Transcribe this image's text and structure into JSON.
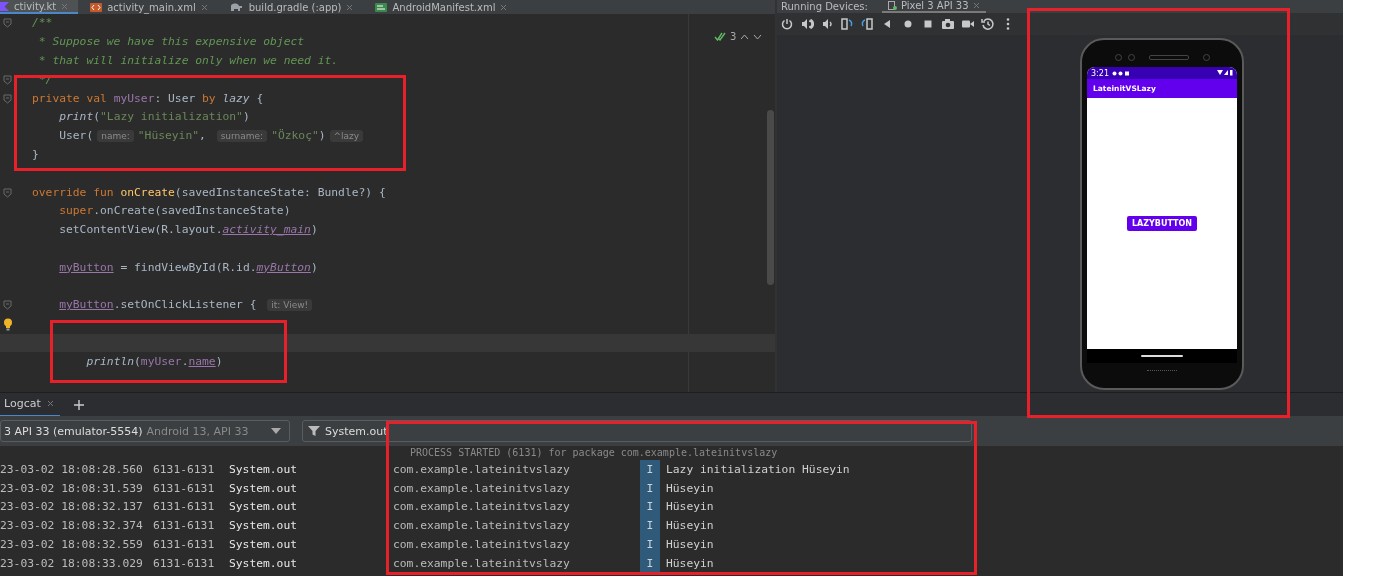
{
  "editor_tabs": [
    {
      "label": "ctivity.kt",
      "kind": "kotlin",
      "selected": true
    },
    {
      "label": "activity_main.xml",
      "kind": "xml",
      "selected": false
    },
    {
      "label": "build.gradle (:app)",
      "kind": "gradle",
      "selected": false
    },
    {
      "label": "AndroidManifest.xml",
      "kind": "manifest",
      "selected": false
    }
  ],
  "inspections": {
    "count": "3"
  },
  "code_lines": [
    {
      "kind": "fold",
      "current": false,
      "tokens": [
        {
          "kind": "comment",
          "text": "/**"
        }
      ]
    },
    {
      "kind": "plain",
      "current": false,
      "tokens": [
        {
          "kind": "comment",
          "text": " * Suppose we have this expensive object"
        }
      ]
    },
    {
      "kind": "plain",
      "current": false,
      "tokens": [
        {
          "kind": "comment",
          "text": " * that will initialize only when we need it."
        }
      ]
    },
    {
      "kind": "fold",
      "current": false,
      "tokens": [
        {
          "kind": "comment",
          "text": " */"
        }
      ]
    },
    {
      "kind": "fold",
      "current": false,
      "tokens": [
        {
          "kind": "keyword",
          "text": "private val "
        },
        {
          "kind": "property",
          "text": "myUser"
        },
        {
          "kind": "plain",
          "text": ": User "
        },
        {
          "kind": "keyword",
          "text": "by "
        },
        {
          "kind": "italic",
          "text": "lazy"
        },
        {
          "kind": "plain",
          "text": " {"
        }
      ]
    },
    {
      "kind": "plain",
      "current": false,
      "tokens": [
        {
          "kind": "italic",
          "text": "    print"
        },
        {
          "kind": "plain",
          "text": "("
        },
        {
          "kind": "string",
          "text": "\"Lazy initialization\""
        },
        {
          "kind": "plain",
          "text": ")"
        }
      ]
    },
    {
      "kind": "plain",
      "current": false,
      "tokens": [
        {
          "kind": "plain",
          "text": "    User("
        },
        {
          "kind": "hint",
          "text": "name:"
        },
        {
          "kind": "string",
          "text": "\"Hüseyin\""
        },
        {
          "kind": "plain",
          "text": ", "
        },
        {
          "kind": "hint",
          "text": "surname:"
        },
        {
          "kind": "string",
          "text": "\"Özkoç\""
        },
        {
          "kind": "plain",
          "text": ")"
        },
        {
          "kind": "hint",
          "text": "^lazy"
        }
      ]
    },
    {
      "kind": "plain",
      "current": false,
      "tokens": [
        {
          "kind": "plain",
          "text": "}"
        }
      ]
    },
    {
      "kind": "plain",
      "current": false
    },
    {
      "kind": "fold",
      "current": false,
      "tokens": [
        {
          "kind": "keyword",
          "text": "override fun "
        },
        {
          "kind": "function",
          "text": "onCreate"
        },
        {
          "kind": "plain",
          "text": "(savedInstanceState: Bundle?) {"
        }
      ]
    },
    {
      "kind": "plain",
      "current": false,
      "tokens": [
        {
          "kind": "keyword",
          "text": "    super"
        },
        {
          "kind": "plain",
          "text": ".onCreate(savedInstanceState)"
        }
      ]
    },
    {
      "kind": "plain",
      "current": false,
      "tokens": [
        {
          "kind": "plain",
          "text": "    setContentView(R.layout."
        },
        {
          "kind": "ref",
          "text": "activity_main"
        },
        {
          "kind": "plain",
          "text": ")"
        }
      ]
    },
    {
      "kind": "plain",
      "current": false
    },
    {
      "kind": "plain",
      "current": false,
      "tokens": [
        {
          "kind": "refplain",
          "text": "    myButton"
        },
        {
          "kind": "plain",
          "text": " = findViewById(R.id."
        },
        {
          "kind": "ref",
          "text": "myButton"
        },
        {
          "kind": "plain",
          "text": ")"
        }
      ]
    },
    {
      "kind": "plain",
      "current": false
    },
    {
      "kind": "fold",
      "current": false,
      "tokens": [
        {
          "kind": "refplain",
          "text": "    myButton"
        },
        {
          "kind": "plain",
          "text": ".setOnClickListener { "
        },
        {
          "kind": "hint",
          "text": "it: View!"
        }
      ]
    },
    {
      "kind": "bulb",
      "current": false
    },
    {
      "kind": "plain",
      "current": true
    },
    {
      "kind": "plain",
      "current": false,
      "tokens": [
        {
          "kind": "italic",
          "text": "        println"
        },
        {
          "kind": "plain",
          "text": "("
        },
        {
          "kind": "property",
          "text": "myUser"
        },
        {
          "kind": "plain",
          "text": "."
        },
        {
          "kind": "refplain",
          "text": "name"
        },
        {
          "kind": "plain",
          "text": ")"
        }
      ]
    },
    {
      "kind": "plain",
      "current": false
    }
  ],
  "running_devices": {
    "label": "Running Devices:",
    "tab": "Pixel 3 API 33"
  },
  "phone": {
    "status_time": "3:21",
    "app_title": "LateinitVSLazy",
    "button": "LAZYBUTTON"
  },
  "logcat": {
    "tab": "Logcat",
    "device": "3 API 33 (emulator-5554)",
    "device_detail": "Android 13, API 33",
    "filter": "System.out",
    "process_line": "PROCESS STARTED (6131) for package com.example.lateinitvslazy",
    "rows": [
      {
        "date": "23-03-02 18:08:28.560",
        "pid": "6131-6131",
        "tag": "System.out",
        "package": "com.example.lateinitvslazy",
        "level": "I",
        "message": "Lazy initialization Hüseyin"
      },
      {
        "date": "23-03-02 18:08:31.539",
        "pid": "6131-6131",
        "tag": "System.out",
        "package": "com.example.lateinitvslazy",
        "level": "I",
        "message": "Hüseyin"
      },
      {
        "date": "23-03-02 18:08:32.137",
        "pid": "6131-6131",
        "tag": "System.out",
        "package": "com.example.lateinitvslazy",
        "level": "I",
        "message": "Hüseyin"
      },
      {
        "date": "23-03-02 18:08:32.374",
        "pid": "6131-6131",
        "tag": "System.out",
        "package": "com.example.lateinitvslazy",
        "level": "I",
        "message": "Hüseyin"
      },
      {
        "date": "23-03-02 18:08:32.559",
        "pid": "6131-6131",
        "tag": "System.out",
        "package": "com.example.lateinitvslazy",
        "level": "I",
        "message": "Hüseyin"
      },
      {
        "date": "23-03-02 18:08:33.029",
        "pid": "6131-6131",
        "tag": "System.out",
        "package": "com.example.lateinitvslazy",
        "level": "I",
        "message": "Hüseyin"
      }
    ]
  },
  "annotations": [
    {
      "kind": "rectangle"
    },
    {
      "kind": "rectangle"
    },
    {
      "kind": "rectangle"
    },
    {
      "kind": "rectangle"
    }
  ]
}
